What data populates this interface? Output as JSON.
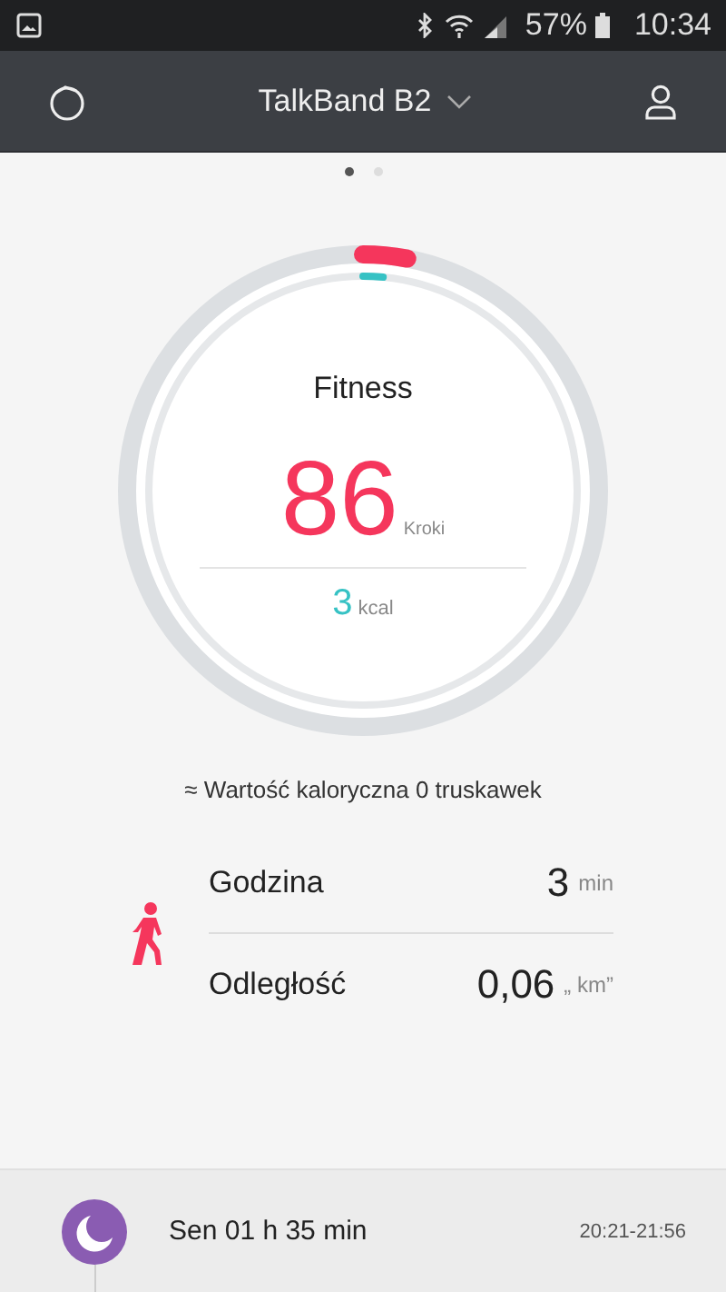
{
  "status_bar": {
    "battery": "57%",
    "time": "10:34"
  },
  "app_bar": {
    "title": "TalkBand B2"
  },
  "pages": [
    {
      "selected": true
    },
    {
      "selected": false
    }
  ],
  "fitness": {
    "title": "Fitness",
    "steps": "86",
    "steps_unit": "Kroki",
    "steps_ring": {
      "level": 0.03
    },
    "kcal": "3",
    "kcal_unit": "kcal",
    "kcal_ring": {
      "level": 0.015
    }
  },
  "calorie_note": "≈ Wartość kaloryczna 0 truskawek",
  "stats": [
    {
      "label": "Godzina",
      "value": "3",
      "unit": "min"
    },
    {
      "label": "Odległość",
      "value": "0,06",
      "unit": "„ km”"
    }
  ],
  "sleep": {
    "label": "Sen 01 h 35 min",
    "time": "20:21-21:56"
  }
}
